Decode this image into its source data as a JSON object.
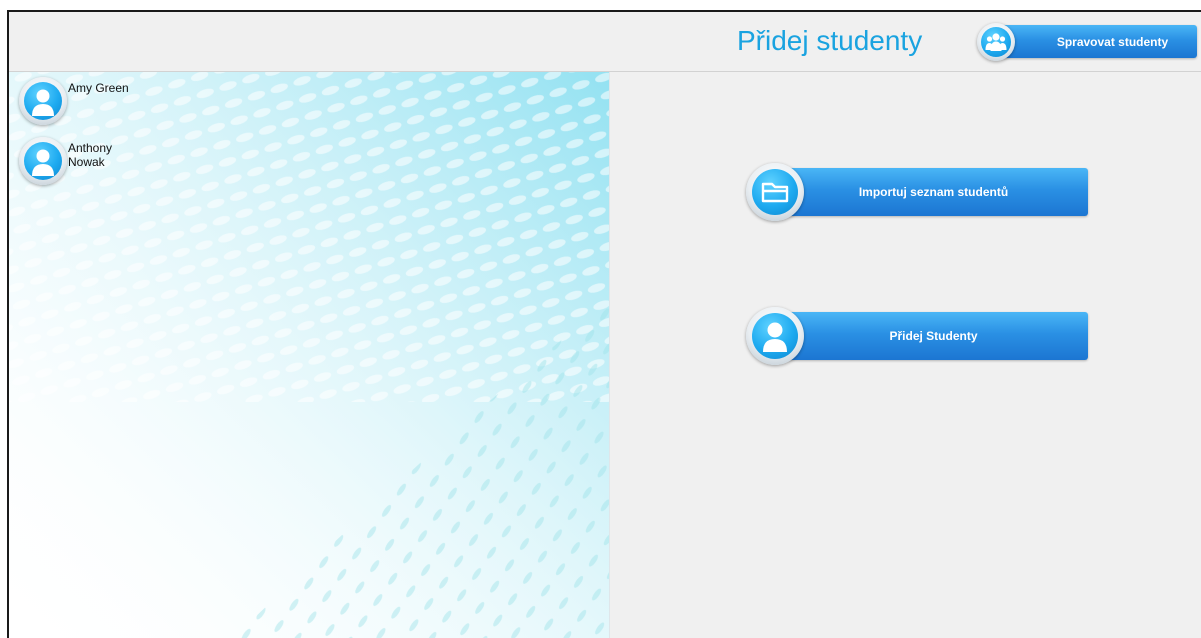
{
  "header": {
    "title": "Přidej studenty",
    "manage_button": "Spravovat studenty",
    "manage_icon": "group-icon"
  },
  "students": [
    {
      "name": "Amy Green",
      "icon": "user-icon"
    },
    {
      "name": "Anthony Nowak",
      "icon": "user-icon"
    }
  ],
  "actions": {
    "import_label": "Importuj seznam studentů",
    "import_icon": "folder-icon",
    "add_label": "Přidej Studenty",
    "add_icon": "user-icon"
  },
  "colors": {
    "accent": "#1aa3e0",
    "button": "#2a90e4",
    "panel_bg": "#f0f0f0"
  }
}
